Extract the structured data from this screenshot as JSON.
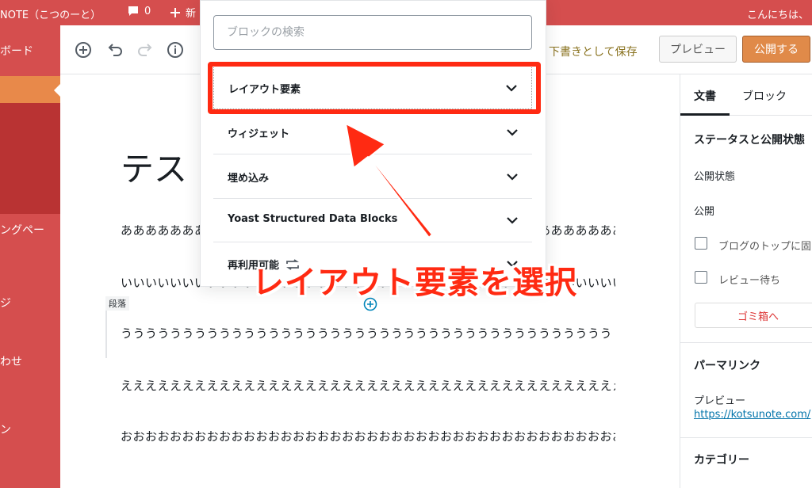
{
  "admin_bar": {
    "site_name": "NOTE（こつのーと）",
    "comment_count": "0",
    "new_label": "新",
    "greeting": "こんにちは、"
  },
  "sidebar": {
    "items": [
      {
        "label": "ボード"
      },
      {
        "label": "ングペー"
      },
      {
        "label": "ジ"
      },
      {
        "label": "わせ"
      },
      {
        "label": "ン"
      }
    ]
  },
  "toolbar": {
    "save_draft_label": "下書きとして保存",
    "preview_label": "プレビュー",
    "publish_label": "公開する"
  },
  "editor": {
    "title_partial": "テス",
    "block_type_label": "段落",
    "paragraphs": [
      "あああああああああああああああああああああああああああああああああああああああああ",
      "いいいいいいいいいいいいいいいいいいいいいいいいいいいいいいいいいいいいいいいいい",
      "うううううううううううううううううううううううううううううううううううううううう",
      "えええええええええええええええええええええええええええええええええええええええええ",
      "おおおおおおおおおおおおおおおおおおおおおおおおおおおおおおおおおおおおおおおおお"
    ]
  },
  "inserter": {
    "search_placeholder": "ブロックの検索",
    "panels": [
      {
        "label": "レイアウト要素"
      },
      {
        "label": "ウィジェット"
      },
      {
        "label": "埋め込み"
      },
      {
        "label": "Yoast Structured Data Blocks"
      },
      {
        "label": "再利用可能"
      }
    ]
  },
  "settings": {
    "tabs": [
      {
        "label": "文書"
      },
      {
        "label": "ブロック"
      }
    ],
    "status_heading": "ステータスと公開状態",
    "visibility_label": "公開状態",
    "publish_label": "公開",
    "sticky_label": "ブログのトップに固",
    "pending_label": "レビュー待ち",
    "trash_label": "ゴミ箱へ",
    "permalink_heading": "パーマリンク",
    "permalink_preview_label": "プレビュー",
    "permalink_url": "https://kotsunote.com/",
    "category_heading": "カテゴリー"
  },
  "annotation": {
    "caption": "レイアウト要素を選択"
  },
  "colors": {
    "admin_red": "#d54e4e",
    "accent_orange": "#e08a49",
    "annotation_red": "#ff2a12"
  }
}
